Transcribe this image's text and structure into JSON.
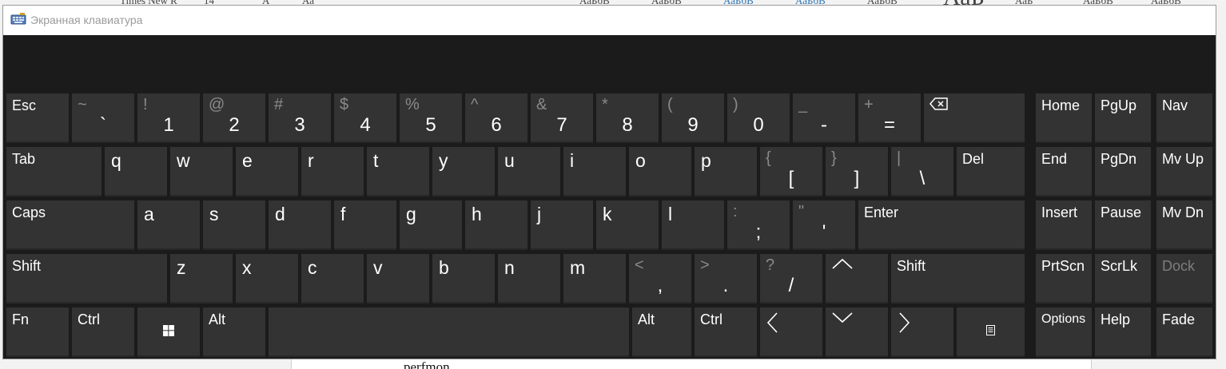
{
  "background": {
    "ribbon_snippets": [
      "Times New R",
      "14",
      "А",
      "Аа",
      "АаБбВ",
      "АаБбВ",
      "АаБбВ",
      "АаБбВ",
      "АаБбВ",
      "АаБ",
      "АаБ",
      "АаБбВ",
      "АаБбВ"
    ],
    "doc_text": "perfmon"
  },
  "window": {
    "title": "Экранная клавиатура",
    "icon": "keyboard-app-icon"
  },
  "keys": {
    "esc": "Esc",
    "num": [
      {
        "shift": "~",
        "main": "`"
      },
      {
        "shift": "!",
        "main": "1"
      },
      {
        "shift": "@",
        "main": "2"
      },
      {
        "shift": "#",
        "main": "3"
      },
      {
        "shift": "$",
        "main": "4"
      },
      {
        "shift": "%",
        "main": "5"
      },
      {
        "shift": "^",
        "main": "6"
      },
      {
        "shift": "&",
        "main": "7"
      },
      {
        "shift": "*",
        "main": "8"
      },
      {
        "shift": "(",
        "main": "9"
      },
      {
        "shift": ")",
        "main": "0"
      },
      {
        "shift": "_",
        "main": "-"
      },
      {
        "shift": "+",
        "main": "="
      }
    ],
    "backspace_icon": "backspace-icon",
    "tab": "Tab",
    "row_q": [
      "q",
      "w",
      "e",
      "r",
      "t",
      "y",
      "u",
      "i",
      "o",
      "p"
    ],
    "brackets": [
      {
        "shift": "{",
        "main": "["
      },
      {
        "shift": "}",
        "main": "]"
      },
      {
        "shift": "|",
        "main": "\\"
      }
    ],
    "del": "Del",
    "caps": "Caps",
    "row_a": [
      "a",
      "s",
      "d",
      "f",
      "g",
      "h",
      "j",
      "k",
      "l"
    ],
    "punct_a": [
      {
        "shift": ":",
        "main": ";"
      },
      {
        "shift": "\"",
        "main": "'"
      }
    ],
    "enter": "Enter",
    "shift_left": "Shift",
    "row_z": [
      "z",
      "x",
      "c",
      "v",
      "b",
      "n",
      "m"
    ],
    "punct_z": [
      {
        "shift": "<",
        "main": ","
      },
      {
        "shift": ">",
        "main": "."
      },
      {
        "shift": "?",
        "main": "/"
      }
    ],
    "arrow_up_icon": "arrow-up-icon",
    "shift_right": "Shift",
    "fn": "Fn",
    "ctrl_left": "Ctrl",
    "win_icon": "windows-logo-icon",
    "alt_left": "Alt",
    "alt_right": "Alt",
    "ctrl_right": "Ctrl",
    "arrow_left_icon": "arrow-left-icon",
    "arrow_down_icon": "arrow-down-icon",
    "arrow_right_icon": "arrow-right-icon",
    "menu_icon": "context-menu-icon",
    "nav": {
      "home": "Home",
      "pgup": "PgUp",
      "nav": "Nav",
      "end": "End",
      "pgdn": "PgDn",
      "mvup": "Mv Up",
      "insert": "Insert",
      "pause": "Pause",
      "mvdn": "Mv Dn",
      "prtscn": "PrtScn",
      "scrlk": "ScrLk",
      "dock": "Dock",
      "options": "Options",
      "help": "Help",
      "fade": "Fade"
    }
  },
  "colors": {
    "key_bg": "#333333",
    "window_bg": "#1b1b1b",
    "shift_char": "#8a8a8a",
    "disabled_text": "#7d7d7d"
  }
}
